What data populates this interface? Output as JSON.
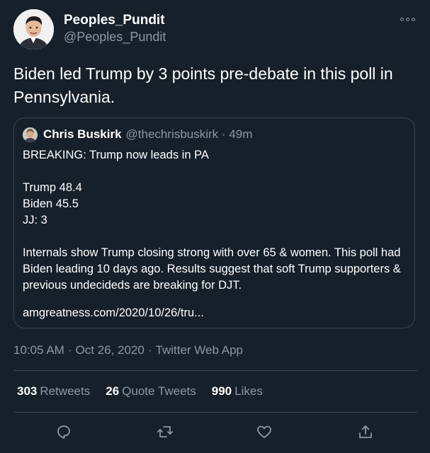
{
  "author": {
    "display_name": "Peoples_Pundit",
    "handle": "@Peoples_Pundit"
  },
  "tweet": {
    "text": "Biden led Trump by 3 points pre-debate in this poll in Pennsylvania."
  },
  "quoted_tweet": {
    "display_name": "Chris Buskirk",
    "handle_and_time": "@thechrisbuskirk · 49m",
    "body": "BREAKING: Trump now leads in PA\n\nTrump 48.4\nBiden 45.5\nJJ: 3\n\nInternals show  Trump closing strong with over 65 & women. This poll had Biden leading 10 days ago. Results suggest that soft Trump supporters & previous undecideds are breaking for DJT.",
    "link": "amgreatness.com/2020/10/26/tru..."
  },
  "meta": {
    "time": "10:05 AM",
    "date": "Oct 26, 2020",
    "source": "Twitter Web App",
    "separator": "·"
  },
  "stats": {
    "retweets_count": "303",
    "retweets_label": "Retweets",
    "quotes_count": "26",
    "quotes_label": "Quote Tweets",
    "likes_count": "990",
    "likes_label": "Likes"
  },
  "colors": {
    "background": "#15202b",
    "text": "#ffffff",
    "secondary": "#8b98a5",
    "border": "#38444d"
  },
  "icons": [
    "more-icon",
    "reply-icon",
    "retweet-icon",
    "like-icon",
    "share-icon"
  ]
}
